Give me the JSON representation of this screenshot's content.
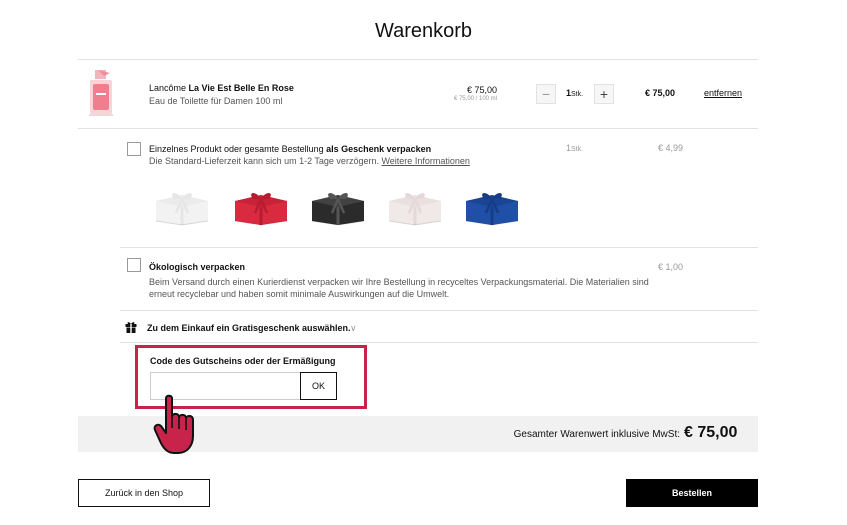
{
  "page": {
    "title": "Warenkorb"
  },
  "product": {
    "brand": "Lancôme",
    "name": "La Vie Est Belle En Rose",
    "desc": "Eau de Toilette für Damen 100 ml",
    "price": "€ 75,00",
    "unit_price": "€ 75,00 / 100 ml",
    "qty": "1",
    "qty_unit": "Stk.",
    "minus": "−",
    "plus": "+",
    "total": "€ 75,00",
    "remove": "entfernen"
  },
  "gift": {
    "text_a": "Einzelnes Produkt oder gesamte Bestellung ",
    "text_b": "als Geschenk verpacken",
    "sub": "Die Standard-Lieferzeit kann sich um 1-2 Tage verzögern. ",
    "link": "Weitere Informationen",
    "qty": "1",
    "qty_unit": "Stk.",
    "price": "€ 4,99",
    "boxes": [
      {
        "color": "#f2f2f2",
        "ribbon": "#e6e6e6"
      },
      {
        "color": "#d92a40",
        "ribbon": "#b81c30"
      },
      {
        "color": "#2b2b2b",
        "ribbon": "#555555"
      },
      {
        "color": "#f1e8e8",
        "ribbon": "#e5d8d8"
      },
      {
        "color": "#1f4fa6",
        "ribbon": "#163d85"
      }
    ]
  },
  "eco": {
    "title": "Ökologisch verpacken",
    "price": "€ 1,00",
    "desc1": "Beim Versand durch einen Kurierdienst verpacken wir Ihre Bestellung in recyceltes Verpackungsmaterial. Die Materialien sind",
    "desc2": "erneut recyclebar und haben somit minimale Auswirkungen auf die Umwelt."
  },
  "free_gift": {
    "label": "Zu dem Einkauf ein Gratisgeschenk auswählen.",
    "chevron": "∨"
  },
  "coupon": {
    "label": "Code des Gutscheins oder der Ermäßigung",
    "value": "",
    "button": "OK"
  },
  "total": {
    "label": "Gesamter Warenwert inklusive MwSt:",
    "value": "€ 75,00"
  },
  "actions": {
    "back": "Zurück in den Shop",
    "order": "Bestellen"
  },
  "colors": {
    "highlight": "#c8234a",
    "dark": "#000000",
    "total_bg": "#f1f1f1"
  },
  "icons": {
    "gift": "gift-icon",
    "hand": "hand-pointer-icon"
  }
}
